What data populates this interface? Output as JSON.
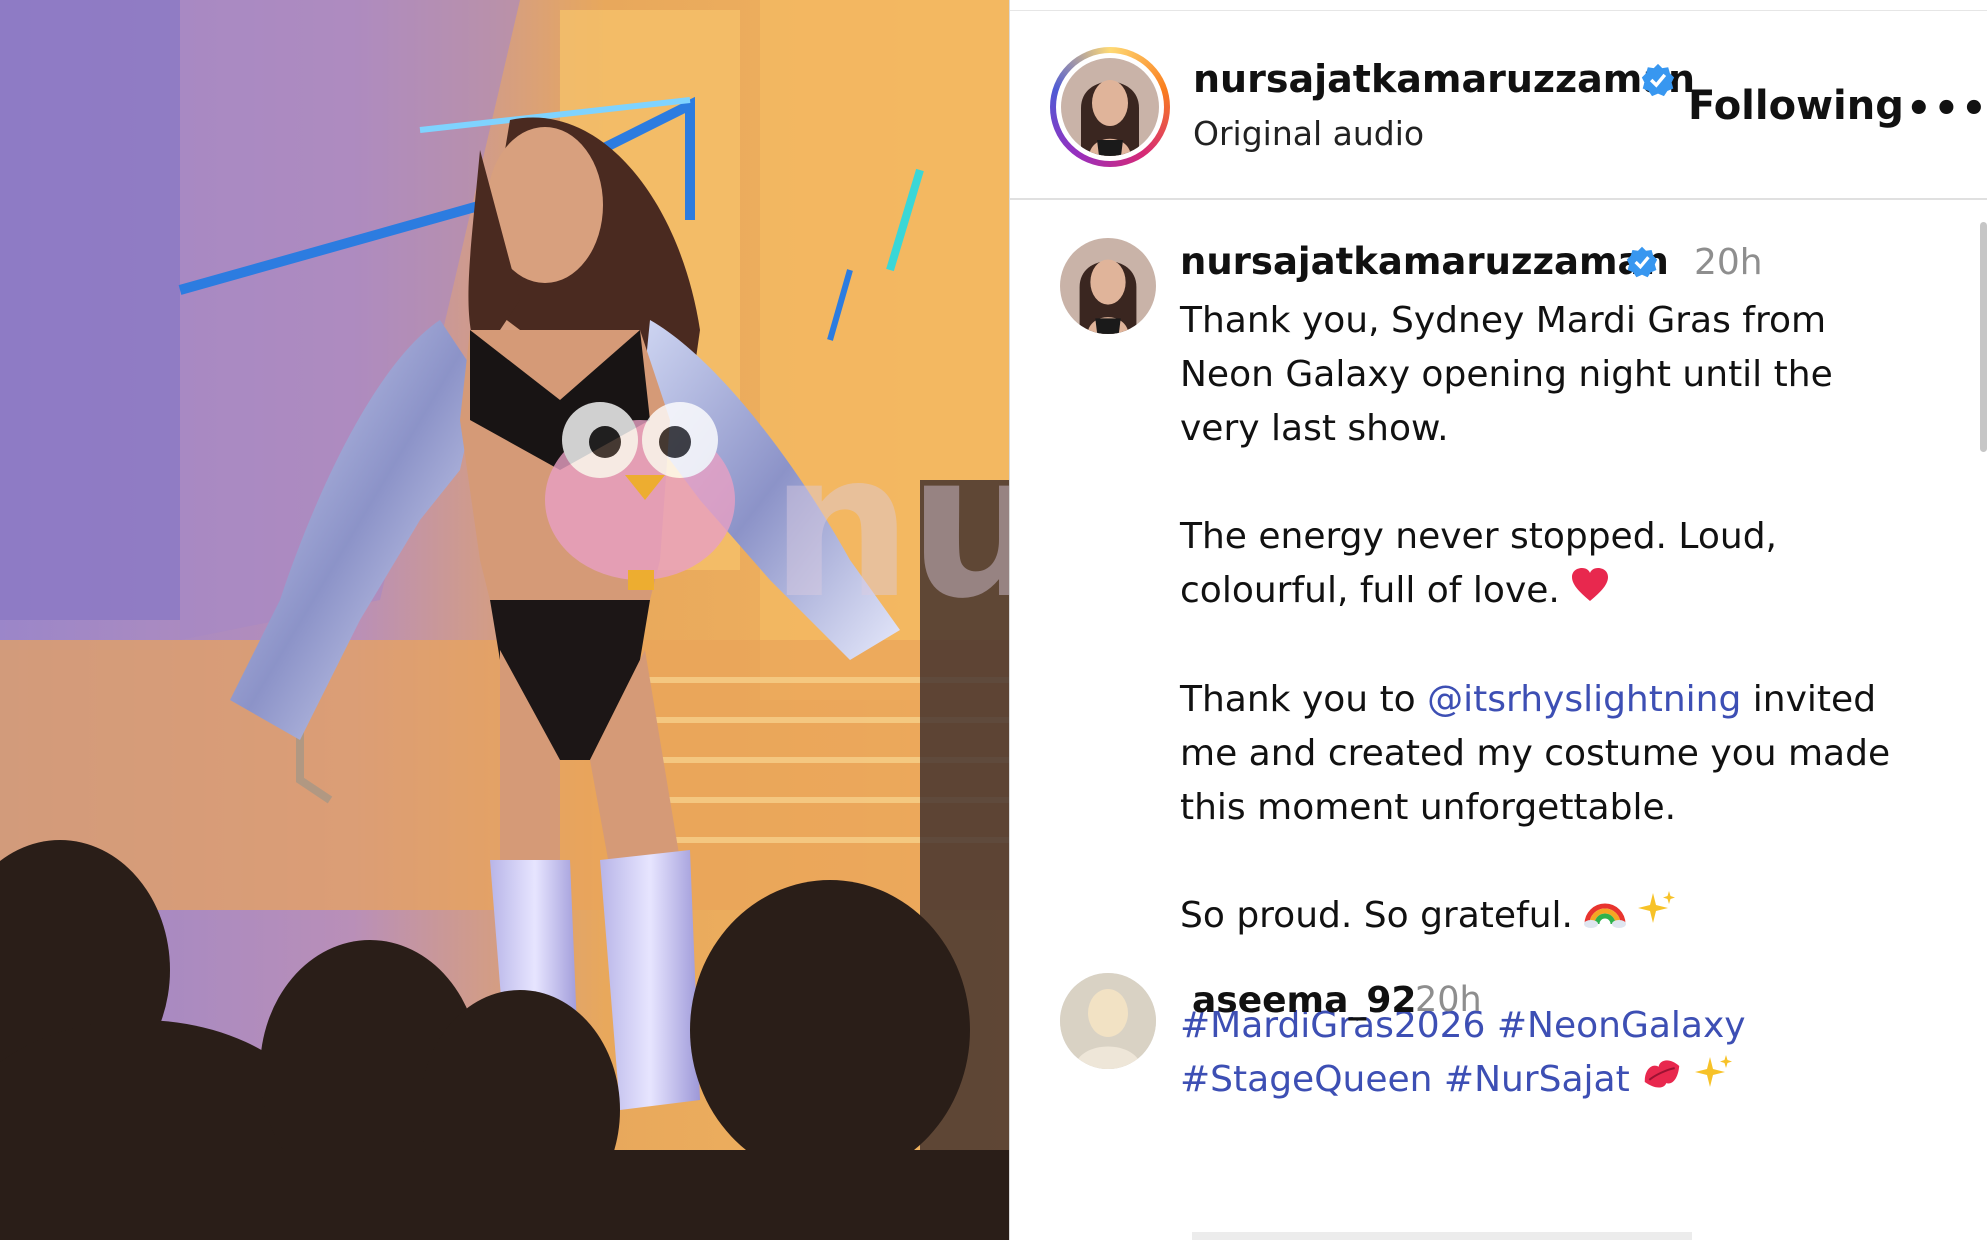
{
  "header": {
    "username": "nursajatkamaruzzaman",
    "subtitle": "Original audio",
    "follow_label": "Following",
    "more_label": "•••"
  },
  "post": {
    "username": "nursajatkamaruzzaman",
    "time": "20h",
    "caption": {
      "line1": "Thank you, Sydney Mardi Gras from",
      "line2": "Neon Galaxy opening night until the",
      "line3": "very last show.",
      "para2_line1": "The energy never stopped. Loud,",
      "para2_line2": "colourful, full of love.",
      "para3_pre": "Thank you to ",
      "para3_mention": "@itsrhyslightning",
      "para3_post": " invited",
      "para3_line2": "me and created my costume you made",
      "para3_line3": "this moment unforgettable.",
      "para4": "So proud. So grateful.",
      "hashtags_line1": "#MardiGras2026 #NeonGalaxy",
      "hashtags_line2": "#StageQueen #NurSajat"
    }
  },
  "comment": {
    "username": "aseema_92",
    "time": "20h"
  },
  "media": {
    "watermark": "nurai"
  },
  "colors": {
    "link": "#3d4fb4",
    "verified": "#3897f0",
    "muted": "#8e8e8e"
  },
  "icons": [
    "verified-badge-icon",
    "red-heart-emoji-icon",
    "rainbow-emoji-icon",
    "sparkles-emoji-icon",
    "kiss-mark-emoji-icon",
    "more-options-icon"
  ]
}
